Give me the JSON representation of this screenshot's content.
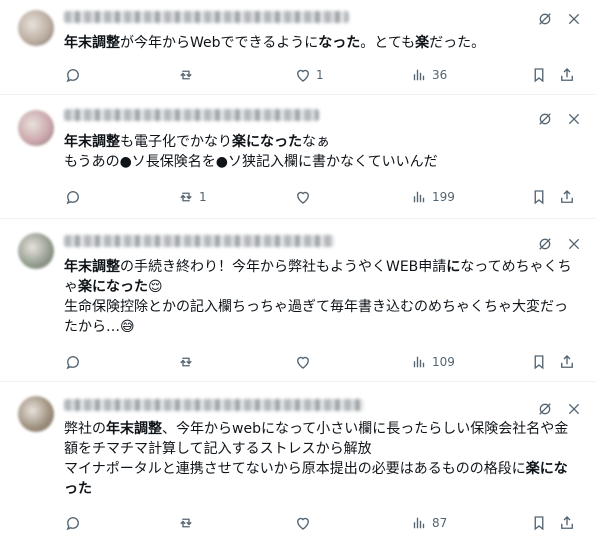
{
  "posts": [
    {
      "text_html": "<b>年末調整</b>が今年からWebでできるように<b>なった</b>。とても<b>楽</b>だった。",
      "reply_count": "",
      "retweet_count": "",
      "like_count": "1",
      "view_count": "36",
      "avatar_color": "#b8a99c"
    },
    {
      "text_html": "<b>年末調整</b>も電子化でかなり<b>楽になった</b>なぁ\nもうあの●ソ長保険名を●ソ狭記入欄に書かなくていいんだ",
      "reply_count": "",
      "retweet_count": "1",
      "like_count": "",
      "view_count": "199",
      "avatar_color": "#c9a3a8"
    },
    {
      "text_html": "<b>年末調整</b>の手続き終わり！今年から弊社もようやくWEB申請<b>に</b>なってめちゃくちゃ<b>楽になった</b>😌\n生命保険控除とかの記入欄ちっちゃ過ぎて毎年書き込むのめちゃくちゃ大変だったから…😅",
      "reply_count": "",
      "retweet_count": "",
      "like_count": "",
      "view_count": "109",
      "avatar_color": "#8f9a8c"
    },
    {
      "text_html": "弊社の<b>年末調整</b>、今年からwebになって小さい欄に長ったらしい保険会社名や金額をチマチマ計算して記入するストレスから解放\nマイナポータルと連携させてないから原本提出の必要はあるものの格段に<b>楽になった</b>",
      "reply_count": "",
      "retweet_count": "",
      "like_count": "",
      "view_count": "87",
      "avatar_color": "#9c8d7a"
    }
  ],
  "icons": {
    "reply": "reply-icon",
    "retweet": "retweet-icon",
    "like": "heart-icon",
    "views": "views-icon",
    "bookmark": "bookmark-icon",
    "share": "share-icon",
    "grok": "grok-icon",
    "more": "more-icon"
  },
  "colors": {
    "icon": "#536471",
    "divider": "#eff3f4",
    "text": "#0f1419"
  }
}
